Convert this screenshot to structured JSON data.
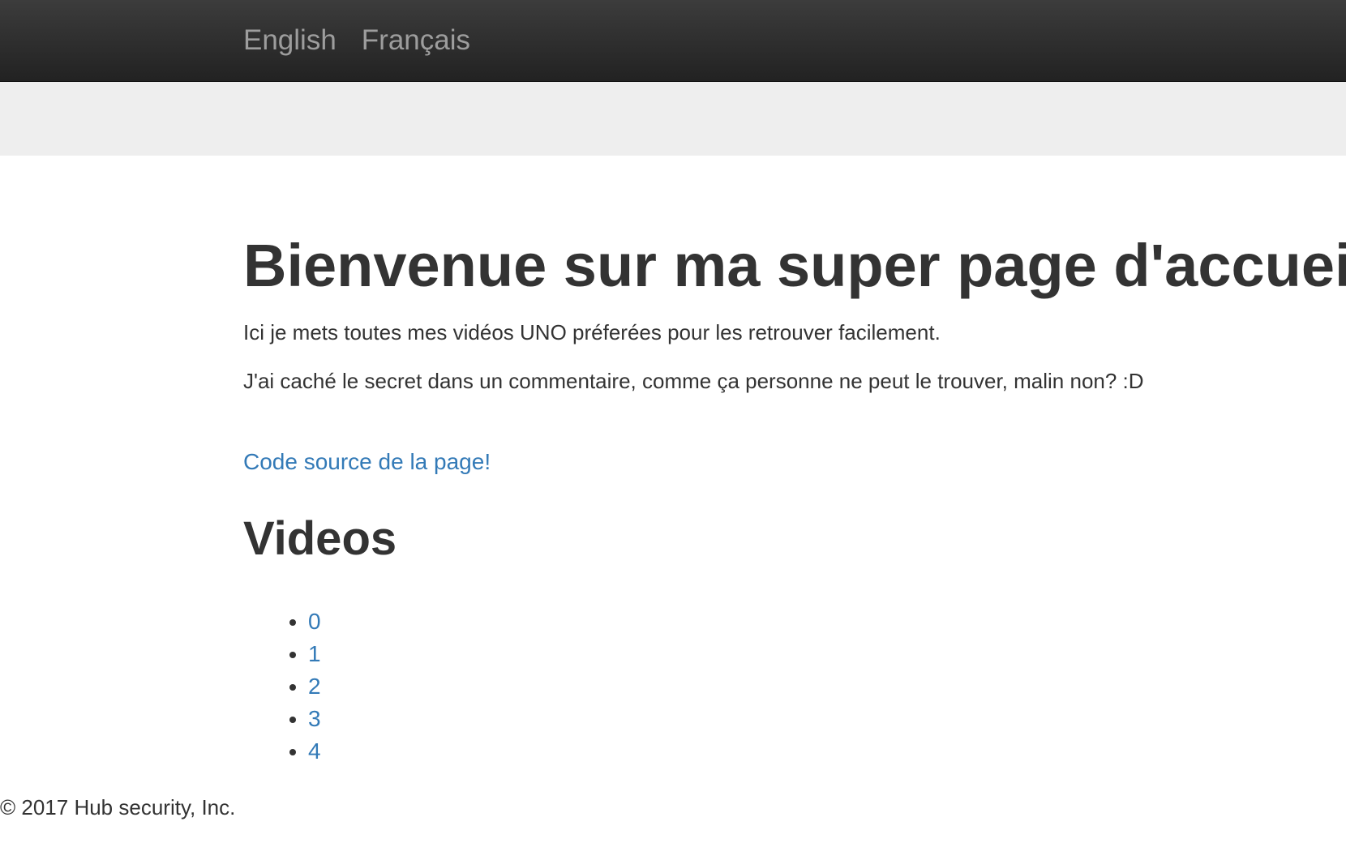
{
  "nav": {
    "links": [
      {
        "label": "English"
      },
      {
        "label": "Français"
      }
    ]
  },
  "main": {
    "title": "Bienvenue sur ma super page d'accueil!",
    "intro_1": "Ici je mets toutes mes vidéos UNO préferées pour les retrouver facilement.",
    "intro_2": "J'ai caché le secret dans un commentaire, comme ça personne ne peut le trouver, malin non? :D",
    "source_link": "Code source de la page!",
    "videos_heading": "Videos",
    "videos": [
      "0",
      "1",
      "2",
      "3",
      "4"
    ]
  },
  "footer": {
    "copyright": "© 2017 Hub security, Inc."
  },
  "colors": {
    "navbar": "#222222",
    "nav_text": "#9d9d9d",
    "jumbotron": "#eeeeee",
    "link": "#337ab7",
    "text": "#333333"
  }
}
